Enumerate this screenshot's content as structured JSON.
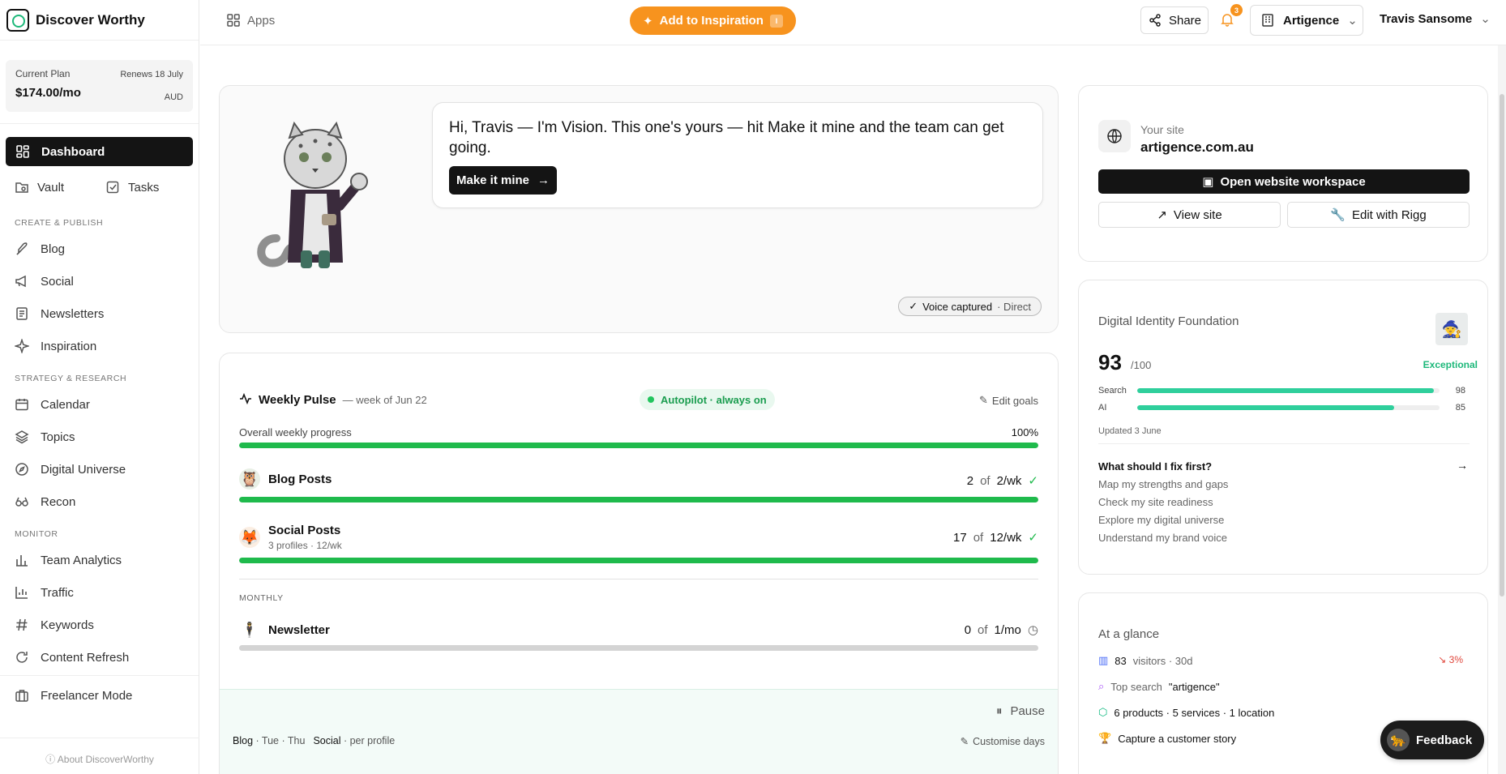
{
  "brand": {
    "name": "Discover Worthy"
  },
  "plan": {
    "label": "Current Plan",
    "renews": "Renews 18 July",
    "price": "$174.00/mo",
    "currency": "AUD"
  },
  "nav": {
    "dashboard": "Dashboard",
    "vault": "Vault",
    "tasks": "Tasks",
    "section_create": "CREATE & PUBLISH",
    "blog": "Blog",
    "social": "Social",
    "newsletters": "Newsletters",
    "inspiration": "Inspiration",
    "section_strategy": "STRATEGY & RESEARCH",
    "calendar": "Calendar",
    "topics": "Topics",
    "digital_universe": "Digital Universe",
    "recon": "Recon",
    "section_monitor": "MONITOR",
    "team_analytics": "Team Analytics",
    "traffic": "Traffic",
    "keywords": "Keywords",
    "content_refresh": "Content Refresh",
    "freelancer_mode": "Freelancer Mode",
    "about": "About DiscoverWorthy"
  },
  "topbar": {
    "apps": "Apps",
    "add_inspiration": "Add to Inspiration",
    "shortcut": "I",
    "share": "Share",
    "notifications_count": "3",
    "org": "Artigence",
    "user": "Travis Sansome"
  },
  "hero": {
    "message": "Hi, Travis — I'm Vision. This one's yours — hit Make it mine and the team can get going.",
    "cta": "Make it mine",
    "voice_status": "Voice captured",
    "voice_mode": "· Direct"
  },
  "pulse": {
    "title": "Weekly Pulse",
    "subtitle": "— week of Jun 22",
    "autopilot": "Autopilot · always on",
    "edit_goals": "Edit goals",
    "overall_label": "Overall weekly progress",
    "overall_value": "100%",
    "overall_fraction": 1.0,
    "goals": [
      {
        "name": "Blog Posts",
        "sub": "",
        "done": "2",
        "of": "of",
        "target": "2/wk",
        "fraction": 1.0
      },
      {
        "name": "Social Posts",
        "sub": "3 profiles · 12/wk",
        "done": "17",
        "of": "of",
        "target": "12/wk",
        "fraction": 1.0
      }
    ],
    "monthly_label": "MONTHLY",
    "newsletter": {
      "name": "Newsletter",
      "done": "0",
      "of": "of",
      "target": "1/mo",
      "fraction": 0
    },
    "pause": "Pause",
    "schedule_blog": "Blog",
    "schedule_blog_days": "· Tue · Thu",
    "schedule_social": "Social",
    "schedule_social_days": "· per profile",
    "customise": "Customise days"
  },
  "site": {
    "label": "Your site",
    "domain": "artigence.com.au",
    "workspace": "Open website workspace",
    "view": "View site",
    "edit": "Edit with Rigg"
  },
  "identity": {
    "title": "Digital Identity Foundation",
    "score": "93",
    "max": "/100",
    "rating": "Exceptional",
    "metrics": [
      {
        "label": "Search",
        "value": "98",
        "fraction": 0.98
      },
      {
        "label": "AI",
        "value": "85",
        "fraction": 0.85
      }
    ],
    "updated": "Updated 3 June",
    "fix_title": "What should I fix first?",
    "fix_links": [
      "Map my strengths and gaps",
      "Check my site readiness",
      "Explore my digital universe",
      "Understand my brand voice"
    ]
  },
  "glance": {
    "title": "At a glance",
    "visitors_count": "83",
    "visitors_text": "visitors · 30d",
    "trend": "↘ 3%",
    "top_search_label": "Top search",
    "top_search_value": "\"artigence\"",
    "catalog": "6 products · 5 services · 1 location",
    "story": "Capture a customer story"
  },
  "feedback": {
    "label": "Feedback"
  },
  "colors": {
    "accent": "#f7931e",
    "progress": "#1fba4c",
    "score": "#2fcf9c",
    "dark": "#141414"
  }
}
